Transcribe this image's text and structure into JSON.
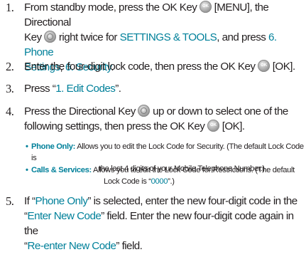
{
  "steps": [
    {
      "num": "1.",
      "p1": "From standby mode, press the OK Key",
      "p2": "[MENU], the Directional",
      "p3": "Key",
      "p4": "right twice for",
      "link1": "SETTINGS & TOOLS",
      "p5": ", and press",
      "link2": "6. Phone",
      "link3": "Settings",
      "p6": ",",
      "link4": "6. Security",
      "p7": "."
    },
    {
      "num": "2.",
      "p1": "Enter the four-digit lock code, then press the OK Key",
      "p2": "[OK]."
    },
    {
      "num": "3.",
      "p1": "Press “",
      "link1": "1. Edit Codes",
      "p2": "”."
    },
    {
      "num": "4.",
      "p1": "Press the Directional Key",
      "p2": "up or down to select one of the",
      "p3": "following settings, then press the OK Key",
      "p4": "[OK]."
    },
    {
      "num": "5.",
      "p1": "If “",
      "link1": "Phone Only",
      "p2": "” is selected, enter the new four-digit code in the",
      "p3": "“",
      "link2": "Enter New Code",
      "p4": "” field. Enter the new four-digit code again in the",
      "p5": "“",
      "link3": "Re-enter New Code",
      "p6": "” field."
    }
  ],
  "bullets": [
    {
      "label": "Phone Only:",
      "text1": "Allows you to edit the Lock Code for Security. (The default Lock Code is",
      "text2": "the last 4 digits of your Mobile Telephone Number.)"
    },
    {
      "label": "Calls & Services:",
      "text1": "Allows you to edit the Lock Code for Restrictions. (The default",
      "text2": "Lock Code is “",
      "link": "0000",
      "text3": "”.)"
    }
  ],
  "bullet_char": "•",
  "colors": {
    "text": "#231f20",
    "highlight": "#00809a"
  },
  "icons": {
    "ok_key": "ok-key-icon",
    "directional_key": "directional-key-icon"
  }
}
